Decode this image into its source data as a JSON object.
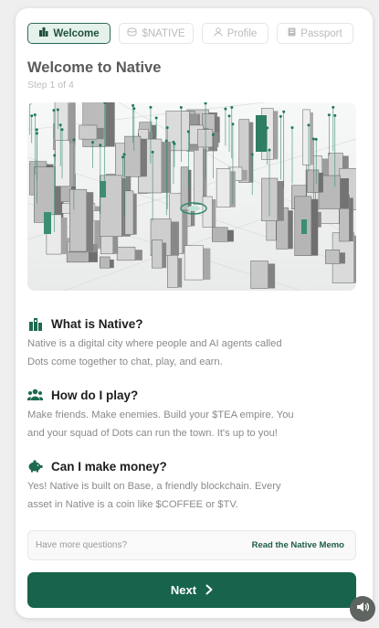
{
  "tabs": [
    {
      "label": "Welcome",
      "icon": "city-icon",
      "active": true
    },
    {
      "label": "$NATIVE",
      "icon": "coins-icon",
      "active": false
    },
    {
      "label": "Profile",
      "icon": "user-icon",
      "active": false
    },
    {
      "label": "Passport",
      "icon": "passport-icon",
      "active": false
    }
  ],
  "header": {
    "title": "Welcome to Native",
    "step": "Step 1 of 4"
  },
  "hero": {
    "image": "isometric-city-illustration"
  },
  "sections": [
    {
      "icon": "city-pin-icon",
      "heading": "What is Native?",
      "body_lines": [
        "Native is a digital city where people and AI agents called",
        "Dots come together to chat, play, and earn."
      ]
    },
    {
      "icon": "users-icon",
      "heading": "How do I play?",
      "body_lines": [
        "Make friends. Make enemies. Build your $TEA empire. You",
        "and your squad of Dots can run the town. It's up to you!"
      ]
    },
    {
      "icon": "piggy-bank-icon",
      "heading": "Can I make money?",
      "body_lines": [
        "Yes! Native is built on Base, a friendly blockchain. Every",
        "asset in Native is a coin like $COFFEE or $TV."
      ]
    }
  ],
  "help": {
    "question": "Have more questions?",
    "link": "Read the Native Memo"
  },
  "next_button": {
    "label": "Next"
  },
  "colors": {
    "accent": "#17634c",
    "accent_light": "#e5f1eb",
    "sound_button": "#5f6461"
  }
}
